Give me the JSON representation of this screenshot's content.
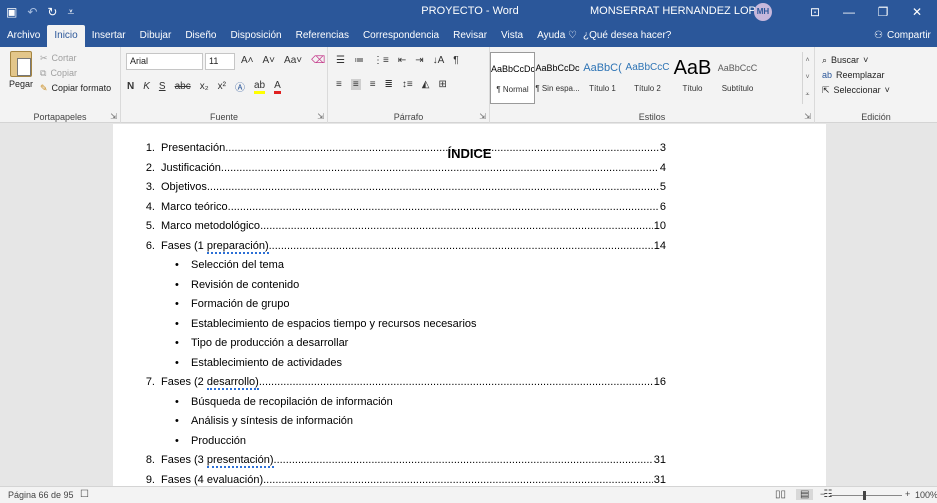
{
  "titlebar": {
    "save_icon": "save-icon",
    "undo_icon": "undo-icon",
    "redo_icon": "redo-icon",
    "title": "PROYECTO - Word",
    "user": "MONSERRAT HERNANDEZ LOPEZ",
    "avatar_initials": "MH"
  },
  "tabs": [
    "Archivo",
    "Inicio",
    "Insertar",
    "Dibujar",
    "Diseño",
    "Disposición",
    "Referencias",
    "Correspondencia",
    "Revisar",
    "Vista",
    "Ayuda"
  ],
  "tell_me": "¿Qué desea hacer?",
  "share": "Compartir",
  "ribbon": {
    "clipboard": {
      "paste": "Pegar",
      "cut": "Cortar",
      "copy": "Copiar",
      "format_painter": "Copiar formato",
      "label": "Portapapeles"
    },
    "font": {
      "name": "Arial",
      "size": "11",
      "label": "Fuente"
    },
    "paragraph": {
      "label": "Párrafo"
    },
    "styles": {
      "label": "Estilos",
      "items": [
        {
          "sample": "AaBbCcDc",
          "name": "¶ Normal"
        },
        {
          "sample": "AaBbCcDc",
          "name": "¶ Sin espa..."
        },
        {
          "sample": "AaBbC(",
          "name": "Título 1"
        },
        {
          "sample": "AaBbCcC",
          "name": "Título 2"
        },
        {
          "sample": "AaB",
          "name": "Título"
        },
        {
          "sample": "AaBbCcC",
          "name": "Subtítulo"
        }
      ]
    },
    "editing": {
      "find": "Buscar",
      "replace": "Reemplazar",
      "select": "Seleccionar",
      "label": "Edición"
    }
  },
  "document": {
    "heading": "ÍNDICE",
    "toc": [
      {
        "num": "1.",
        "text": "Presentación",
        "page": "3"
      },
      {
        "num": "2.",
        "text": "Justificación",
        "page": "4"
      },
      {
        "num": "3.",
        "text": "Objetivos",
        "page": "5"
      },
      {
        "num": "4.",
        "text": "Marco teórico",
        "page": "6"
      },
      {
        "num": "5.",
        "text": "Marco metodológico",
        "page": "10"
      },
      {
        "num": "6.",
        "text_pre": "Fases (1 ",
        "text_sq": "preparación)",
        "page": "14"
      },
      {
        "num": "7.",
        "text_pre": "Fases (2 ",
        "text_sq": "desarrollo)",
        "page": "16"
      },
      {
        "num": "8.",
        "text_pre": "Fases (3 ",
        "text_sq": "presentación)",
        "page": "31"
      },
      {
        "num": "9.",
        "text_pre": "Fases (4 ",
        "text_sq": "evaluación)",
        "page": "31"
      }
    ],
    "bullets_phase1": [
      "Selección del tema",
      "Revisión de contenido",
      "Formación de grupo",
      "Establecimiento de espacios tiempo y recursos necesarios",
      "Tipo de producción a desarrollar",
      "Establecimiento de actividades"
    ],
    "bullets_phase2": [
      "Búsqueda de recopilación de información",
      "Análisis y síntesis de información",
      "Producción"
    ]
  },
  "status": {
    "page": "Página 66 de 95",
    "zoom": "100%"
  },
  "colors": {
    "word_blue": "#2b579a",
    "spellcheck": "#2b6fd6"
  }
}
